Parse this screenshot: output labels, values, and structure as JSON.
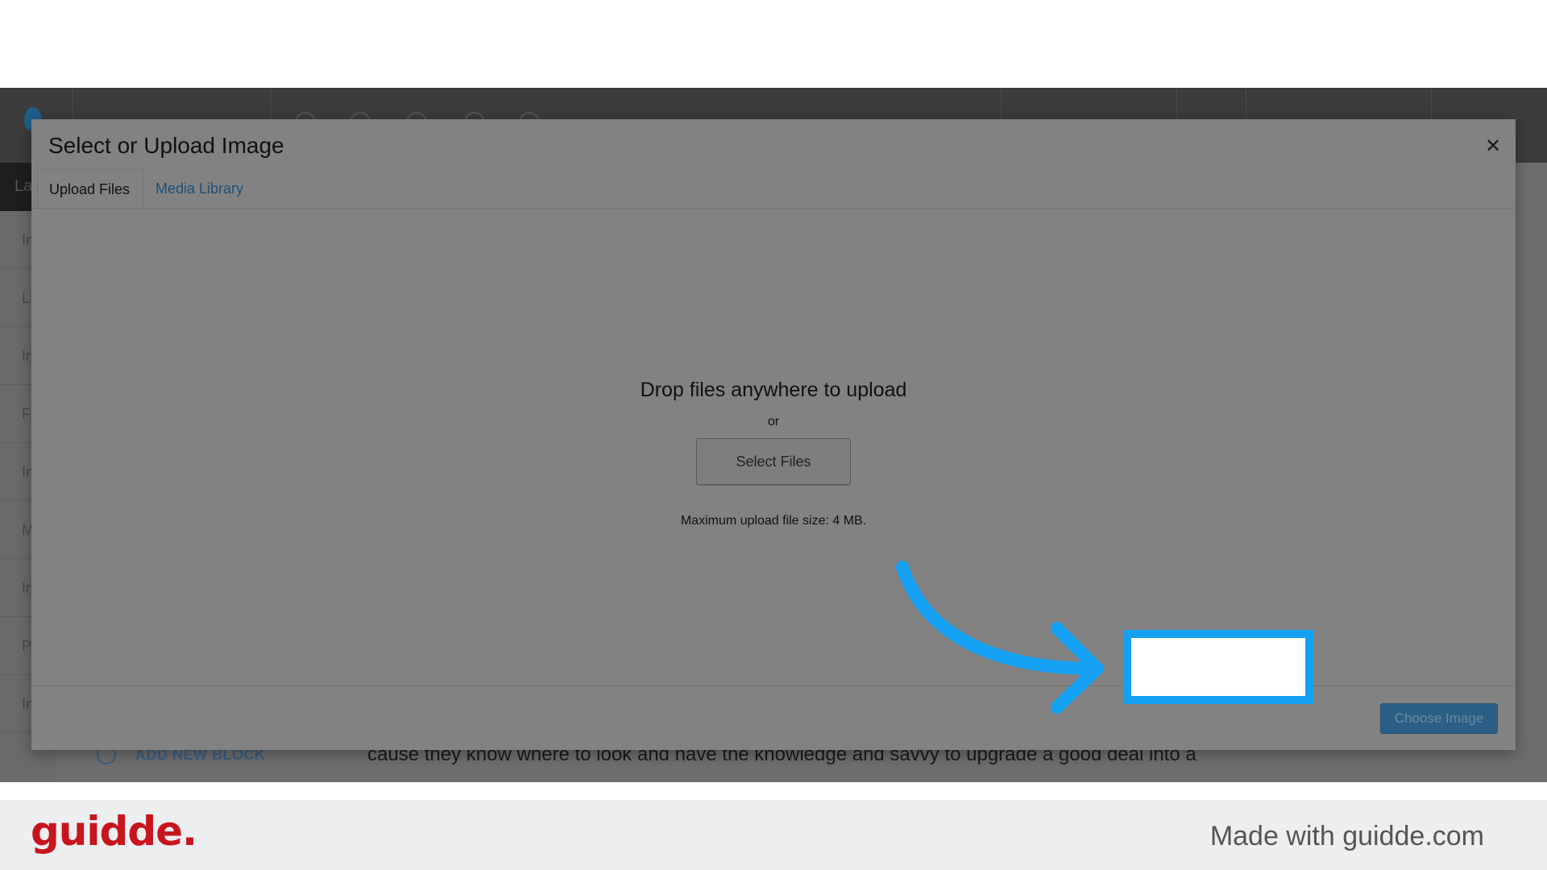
{
  "modal": {
    "title": "Select or Upload Image",
    "close_symbol": "✕",
    "tabs": [
      {
        "label": "Upload Files",
        "active": true
      },
      {
        "label": "Media Library",
        "active": false
      }
    ],
    "drop_text": "Drop files anywhere to upload",
    "or_text": "or",
    "select_files_label": "Select Files",
    "max_upload_text": "Maximum upload file size: 4 MB.",
    "choose_image_label": "Choose Image"
  },
  "background": {
    "add_block_label": "ADD NEW BLOCK",
    "paragraph_text": "cause they know where to look and have the knowledge and savvy to upgrade a good deal into a",
    "sidebar_items": [
      "La",
      "In",
      "L",
      "In",
      "F",
      "In",
      "M",
      "In",
      "P",
      "In"
    ]
  },
  "branding": {
    "logo_text": "guidde.",
    "made_with_text": "Made with guidde.com",
    "logo_color": "#c8151d",
    "highlight_color": "#15a1f3"
  }
}
